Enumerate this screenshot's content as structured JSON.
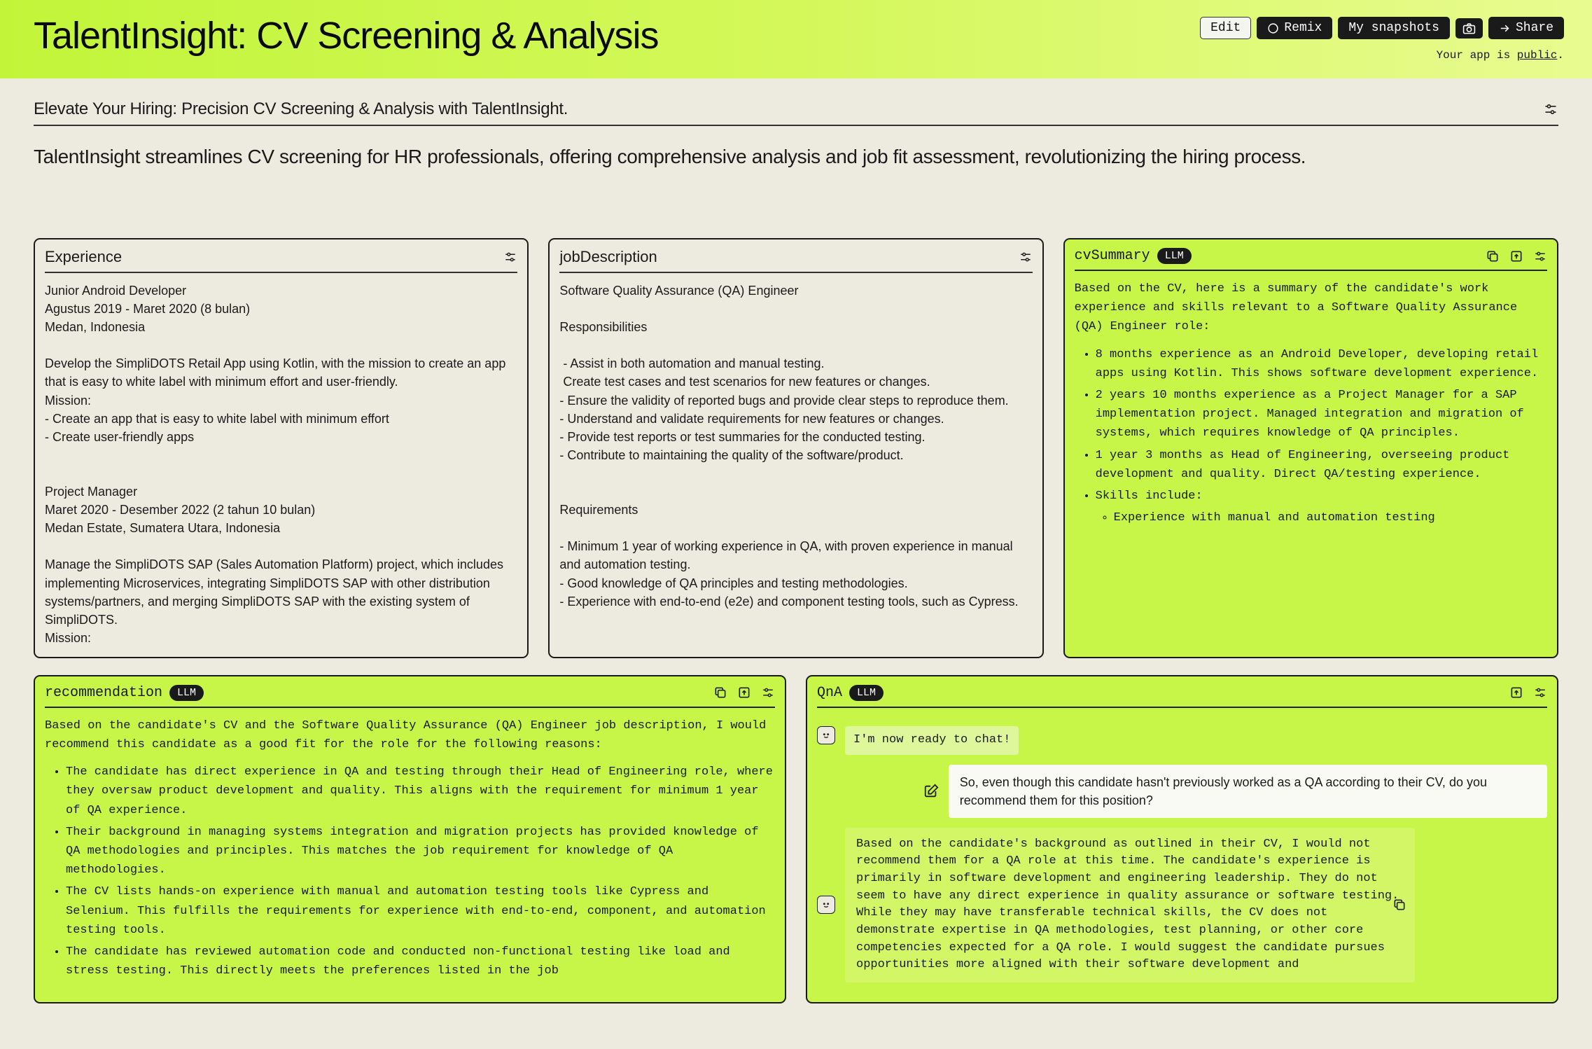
{
  "header": {
    "title": "TalentInsight: CV Screening & Analysis",
    "edit": "Edit",
    "remix": "Remix",
    "snapshots": "My snapshots",
    "share": "Share",
    "public_prefix": "Your app is ",
    "public_word": "public",
    "public_suffix": "."
  },
  "subheader": "Elevate Your Hiring: Precision CV Screening & Analysis with TalentInsight.",
  "description": "TalentInsight streamlines CV screening for HR professionals, offering comprehensive analysis and job fit assessment, revolutionizing the hiring process.",
  "experience": {
    "title": "Experience",
    "body": "Junior Android Developer\nAgustus 2019 - Maret 2020 (8 bulan)\nMedan, Indonesia\n\nDevelop the SimpliDOTS Retail App using Kotlin, with the mission to create an app that is easy to white label with minimum effort and user-friendly.\nMission:\n- Create an app that is easy to white label with minimum effort\n- Create user-friendly apps\n\n\nProject Manager\nMaret 2020 - Desember 2022 (2 tahun 10 bulan)\nMedan Estate, Sumatera Utara, Indonesia\n\nManage the SimpliDOTS SAP (Sales Automation Platform) project, which includes implementing Microservices, integrating SimpliDOTS SAP with other distribution systems/partners, and merging SimpliDOTS SAP with the existing system of SimpliDOTS.\nMission:"
  },
  "jobDescription": {
    "title": "jobDescription",
    "body": "Software Quality Assurance (QA) Engineer\n\nResponsibilities\n\n - Assist in both automation and manual testing.\n Create test cases and test scenarios for new features or changes.\n- Ensure the validity of reported bugs and provide clear steps to reproduce them.\n- Understand and validate requirements for new features or changes.\n- Provide test reports or test summaries for the conducted testing.\n- Contribute to maintaining the quality of the software/product.\n\n\nRequirements\n\n- Minimum 1 year of working experience in QA, with proven experience in manual and automation testing.\n- Good knowledge of QA principles and testing methodologies.\n- Experience with end-to-end (e2e) and component testing tools, such as Cypress."
  },
  "cvSummary": {
    "title": "cvSummary",
    "badge": "LLM",
    "intro": "Based on the CV, here is a summary of the candidate's work experience and skills relevant to a Software Quality Assurance (QA) Engineer role:",
    "items": [
      "8 months experience as an Android Developer, developing retail apps using Kotlin. This shows software development experience.",
      "2 years 10 months experience as a Project Manager for a SAP implementation project. Managed integration and migration of systems, which requires knowledge of QA principles.",
      "1 year 3 months as Head of Engineering, overseeing product development and quality. Direct QA/testing experience.",
      "Skills include:"
    ],
    "subitem": "Experience with manual and automation testing"
  },
  "recommendation": {
    "title": "recommendation",
    "badge": "LLM",
    "intro": "Based on the candidate's CV and the Software Quality Assurance (QA) Engineer job description, I would recommend this candidate as a good fit for the role for the following reasons:",
    "items": [
      "The candidate has direct experience in QA and testing through their Head of Engineering role, where they oversaw product development and quality. This aligns with the requirement for minimum 1 year of QA experience.",
      "Their background in managing systems integration and migration projects has provided knowledge of QA methodologies and principles. This matches the job requirement for knowledge of QA methodologies.",
      "The CV lists hands-on experience with manual and automation testing tools like Cypress and Selenium. This fulfills the requirements for experience with end-to-end, component, and automation testing tools.",
      "The candidate has reviewed automation code and conducted non-functional testing like load and stress testing. This directly meets the preferences listed in the job"
    ]
  },
  "qna": {
    "title": "QnA",
    "badge": "LLM",
    "ready": "I'm now ready to chat!",
    "user_msg": "So, even though this candidate hasn't previously worked as a QA according to their CV, do you recommend them for this position?",
    "bot_msg": "Based on the candidate's background as outlined in their CV, I would not recommend them for a QA role at this time. The candidate's experience is primarily in software development and engineering leadership. They do not seem to have any direct experience in quality assurance or software testing. While they may have transferable technical skills, the CV does not demonstrate expertise in QA methodologies, test planning, or other core competencies expected for a QA role. I would suggest the candidate pursues opportunities more aligned with their software development and"
  }
}
